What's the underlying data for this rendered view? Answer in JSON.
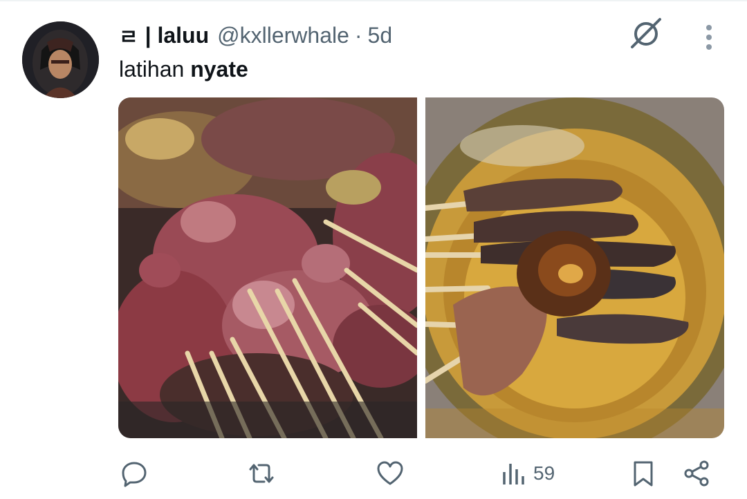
{
  "tweet": {
    "badge": "ㄹ",
    "display_name": "| laluu",
    "handle": "@kxllerwhale",
    "separator": "·",
    "time": "5d",
    "text_plain": "latihan ",
    "text_bold": "nyate",
    "images": [
      {
        "icon": "raw-satay-skewers-photo"
      },
      {
        "icon": "grilled-satay-plate-photo"
      }
    ]
  },
  "actions": {
    "reply_icon": "reply-icon",
    "retweet_icon": "retweet-icon",
    "like_icon": "heart-icon",
    "views_icon": "views-icon",
    "views_count": "59",
    "bookmark_icon": "bookmark-icon",
    "share_icon": "share-icon"
  },
  "colors": {
    "text_primary": "#0f1419",
    "text_secondary": "#536471",
    "divider": "#eff3f4"
  }
}
